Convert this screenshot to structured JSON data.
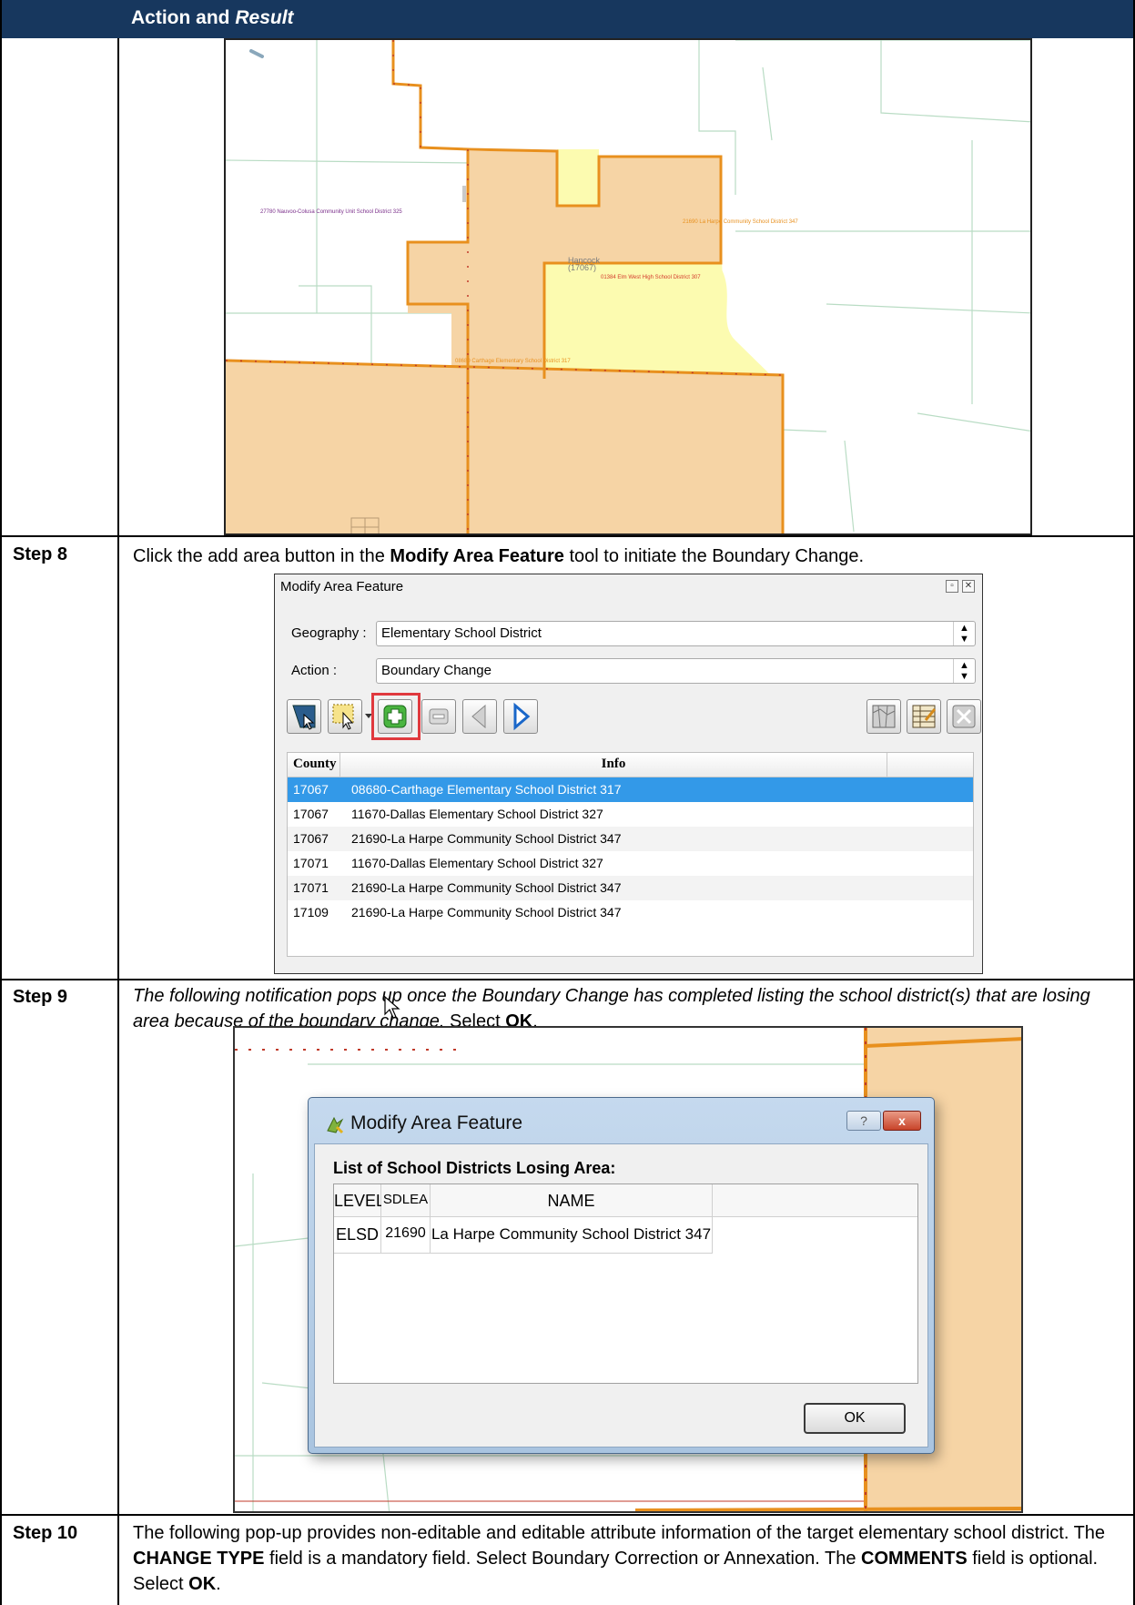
{
  "header": {
    "title_plain": "Action and",
    "title_italic": "Result"
  },
  "map1": {
    "labels": [
      "27780 Nauvoo-Colusa Community Unit School District 325",
      "21690 La Harpe Community School District 347",
      "Hancock",
      "(17067)",
      "01384 Elm West High School District 307",
      "08680 Carthage Elementary School District 317"
    ]
  },
  "step8": {
    "label": "Step 8",
    "text_before": "Click the add area button in the ",
    "text_bold": "Modify Area Feature",
    "text_after": " tool to initiate the Boundary Change."
  },
  "modify_panel": {
    "title": "Modify Area Feature",
    "geography_label": "Geography :",
    "geography_value": "Elementary School District",
    "action_label": "Action :",
    "action_value": "Boundary Change",
    "columns": [
      "County",
      "Info"
    ],
    "rows": [
      {
        "county": "17067",
        "info": "08680-Carthage Elementary School District 317",
        "selected": true
      },
      {
        "county": "17067",
        "info": "11670-Dallas Elementary School District 327"
      },
      {
        "county": "17067",
        "info": "21690-La Harpe Community School District 347"
      },
      {
        "county": "17071",
        "info": "11670-Dallas Elementary School District 327"
      },
      {
        "county": "17071",
        "info": "21690-La Harpe Community School District 347"
      },
      {
        "county": "17109",
        "info": "21690-La Harpe Community School District 347"
      }
    ],
    "icons": [
      "select-feature-icon",
      "select-rectangle-icon",
      "add-area-icon",
      "remove-area-icon",
      "previous-icon",
      "next-icon",
      "map-icon",
      "attribute-table-icon",
      "clear-icon"
    ]
  },
  "step9": {
    "label": "Step 9",
    "text_italic": "The following notification pops up once the Boundary Change has completed listing the school district(s) that are losing area because of the boundary change.",
    "text_select": " Select ",
    "text_ok": "OK",
    "text_end": "."
  },
  "dialog": {
    "title": "Modify Area Feature",
    "help": "?",
    "close": "x",
    "heading": "List of School Districts Losing Area:",
    "columns": [
      "LEVEL",
      "SDLEA",
      "NAME"
    ],
    "row": {
      "level": "ELSD",
      "sdlea": "21690",
      "name": "La Harpe Community School District 347"
    },
    "ok": "OK"
  },
  "step10": {
    "label": "Step 10",
    "p1": "The following pop-up provides non-editable and editable attribute information of the target elementary school district. The ",
    "b1": "CHANGE TYPE",
    "p2": " field is a mandatory field. Select Boundary Correction or Annexation. The ",
    "b2": "COMMENTS",
    "p3": " field is optional. Select ",
    "b3": "OK",
    "p4": "."
  },
  "colors": {
    "header_bg": "#17375e",
    "area_orange": "#f6d4a5",
    "area_yellow": "#fcfbb0",
    "boundary_orange": "#e8901e",
    "selection_blue": "#3399e8",
    "highlight_red": "#e0393e"
  }
}
